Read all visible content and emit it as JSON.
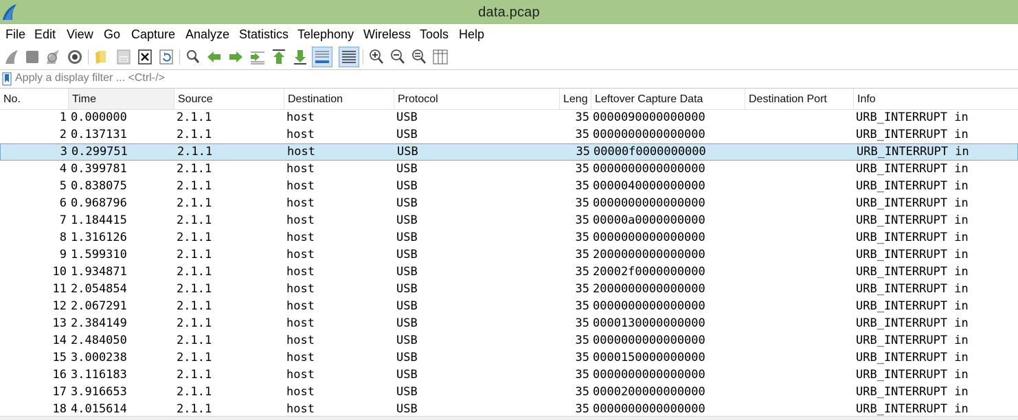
{
  "window": {
    "title": "data.pcap"
  },
  "menu": [
    "File",
    "Edit",
    "View",
    "Go",
    "Capture",
    "Analyze",
    "Statistics",
    "Telephony",
    "Wireless",
    "Tools",
    "Help"
  ],
  "toolbar_icons": [
    "start-capture-icon",
    "stop-capture-icon",
    "restart-capture-icon",
    "capture-options-icon",
    "open-file-icon",
    "save-file-icon",
    "close-file-icon",
    "reload-file-icon",
    "find-packet-icon",
    "go-back-icon",
    "go-forward-icon",
    "go-to-packet-icon",
    "go-first-packet-icon",
    "go-last-packet-icon",
    "autoscroll-icon",
    "colorize-icon",
    "zoom-in-icon",
    "zoom-out-icon",
    "zoom-normal-icon",
    "resize-columns-icon"
  ],
  "filter": {
    "placeholder": "Apply a display filter ... <Ctrl-/>",
    "value": ""
  },
  "columns": [
    "No.",
    "Time",
    "Source",
    "Destination",
    "Protocol",
    "Leng",
    "Leftover Capture Data",
    "Destination Port",
    "Info"
  ],
  "selected_row": 3,
  "packets": [
    {
      "no": "1",
      "time": "0.000000",
      "source": "2.1.1",
      "destination": "host",
      "protocol": "USB",
      "length": "35",
      "data": "0000090000000000",
      "port": "",
      "info": "URB_INTERRUPT in"
    },
    {
      "no": "2",
      "time": "0.137131",
      "source": "2.1.1",
      "destination": "host",
      "protocol": "USB",
      "length": "35",
      "data": "0000000000000000",
      "port": "",
      "info": "URB_INTERRUPT in"
    },
    {
      "no": "3",
      "time": "0.299751",
      "source": "2.1.1",
      "destination": "host",
      "protocol": "USB",
      "length": "35",
      "data": "00000f0000000000",
      "port": "",
      "info": "URB_INTERRUPT in"
    },
    {
      "no": "4",
      "time": "0.399781",
      "source": "2.1.1",
      "destination": "host",
      "protocol": "USB",
      "length": "35",
      "data": "0000000000000000",
      "port": "",
      "info": "URB_INTERRUPT in"
    },
    {
      "no": "5",
      "time": "0.838075",
      "source": "2.1.1",
      "destination": "host",
      "protocol": "USB",
      "length": "35",
      "data": "0000040000000000",
      "port": "",
      "info": "URB_INTERRUPT in"
    },
    {
      "no": "6",
      "time": "0.968796",
      "source": "2.1.1",
      "destination": "host",
      "protocol": "USB",
      "length": "35",
      "data": "0000000000000000",
      "port": "",
      "info": "URB_INTERRUPT in"
    },
    {
      "no": "7",
      "time": "1.184415",
      "source": "2.1.1",
      "destination": "host",
      "protocol": "USB",
      "length": "35",
      "data": "00000a0000000000",
      "port": "",
      "info": "URB_INTERRUPT in"
    },
    {
      "no": "8",
      "time": "1.316126",
      "source": "2.1.1",
      "destination": "host",
      "protocol": "USB",
      "length": "35",
      "data": "0000000000000000",
      "port": "",
      "info": "URB_INTERRUPT in"
    },
    {
      "no": "9",
      "time": "1.599310",
      "source": "2.1.1",
      "destination": "host",
      "protocol": "USB",
      "length": "35",
      "data": "2000000000000000",
      "port": "",
      "info": "URB_INTERRUPT in"
    },
    {
      "no": "10",
      "time": "1.934871",
      "source": "2.1.1",
      "destination": "host",
      "protocol": "USB",
      "length": "35",
      "data": "20002f0000000000",
      "port": "",
      "info": "URB_INTERRUPT in"
    },
    {
      "no": "11",
      "time": "2.054854",
      "source": "2.1.1",
      "destination": "host",
      "protocol": "USB",
      "length": "35",
      "data": "2000000000000000",
      "port": "",
      "info": "URB_INTERRUPT in"
    },
    {
      "no": "12",
      "time": "2.067291",
      "source": "2.1.1",
      "destination": "host",
      "protocol": "USB",
      "length": "35",
      "data": "0000000000000000",
      "port": "",
      "info": "URB_INTERRUPT in"
    },
    {
      "no": "13",
      "time": "2.384149",
      "source": "2.1.1",
      "destination": "host",
      "protocol": "USB",
      "length": "35",
      "data": "0000130000000000",
      "port": "",
      "info": "URB_INTERRUPT in"
    },
    {
      "no": "14",
      "time": "2.484050",
      "source": "2.1.1",
      "destination": "host",
      "protocol": "USB",
      "length": "35",
      "data": "0000000000000000",
      "port": "",
      "info": "URB_INTERRUPT in"
    },
    {
      "no": "15",
      "time": "3.000238",
      "source": "2.1.1",
      "destination": "host",
      "protocol": "USB",
      "length": "35",
      "data": "0000150000000000",
      "port": "",
      "info": "URB_INTERRUPT in"
    },
    {
      "no": "16",
      "time": "3.116183",
      "source": "2.1.1",
      "destination": "host",
      "protocol": "USB",
      "length": "35",
      "data": "0000000000000000",
      "port": "",
      "info": "URB_INTERRUPT in"
    },
    {
      "no": "17",
      "time": "3.916653",
      "source": "2.1.1",
      "destination": "host",
      "protocol": "USB",
      "length": "35",
      "data": "0000200000000000",
      "port": "",
      "info": "URB_INTERRUPT in"
    },
    {
      "no": "18",
      "time": "4.015614",
      "source": "2.1.1",
      "destination": "host",
      "protocol": "USB",
      "length": "35",
      "data": "0000000000000000",
      "port": "",
      "info": "URB_INTERRUPT in"
    }
  ],
  "colors": {
    "titlebar": "#a6c88b",
    "selected_row": "#cce8f4",
    "selected_border": "#6ab0d8"
  }
}
